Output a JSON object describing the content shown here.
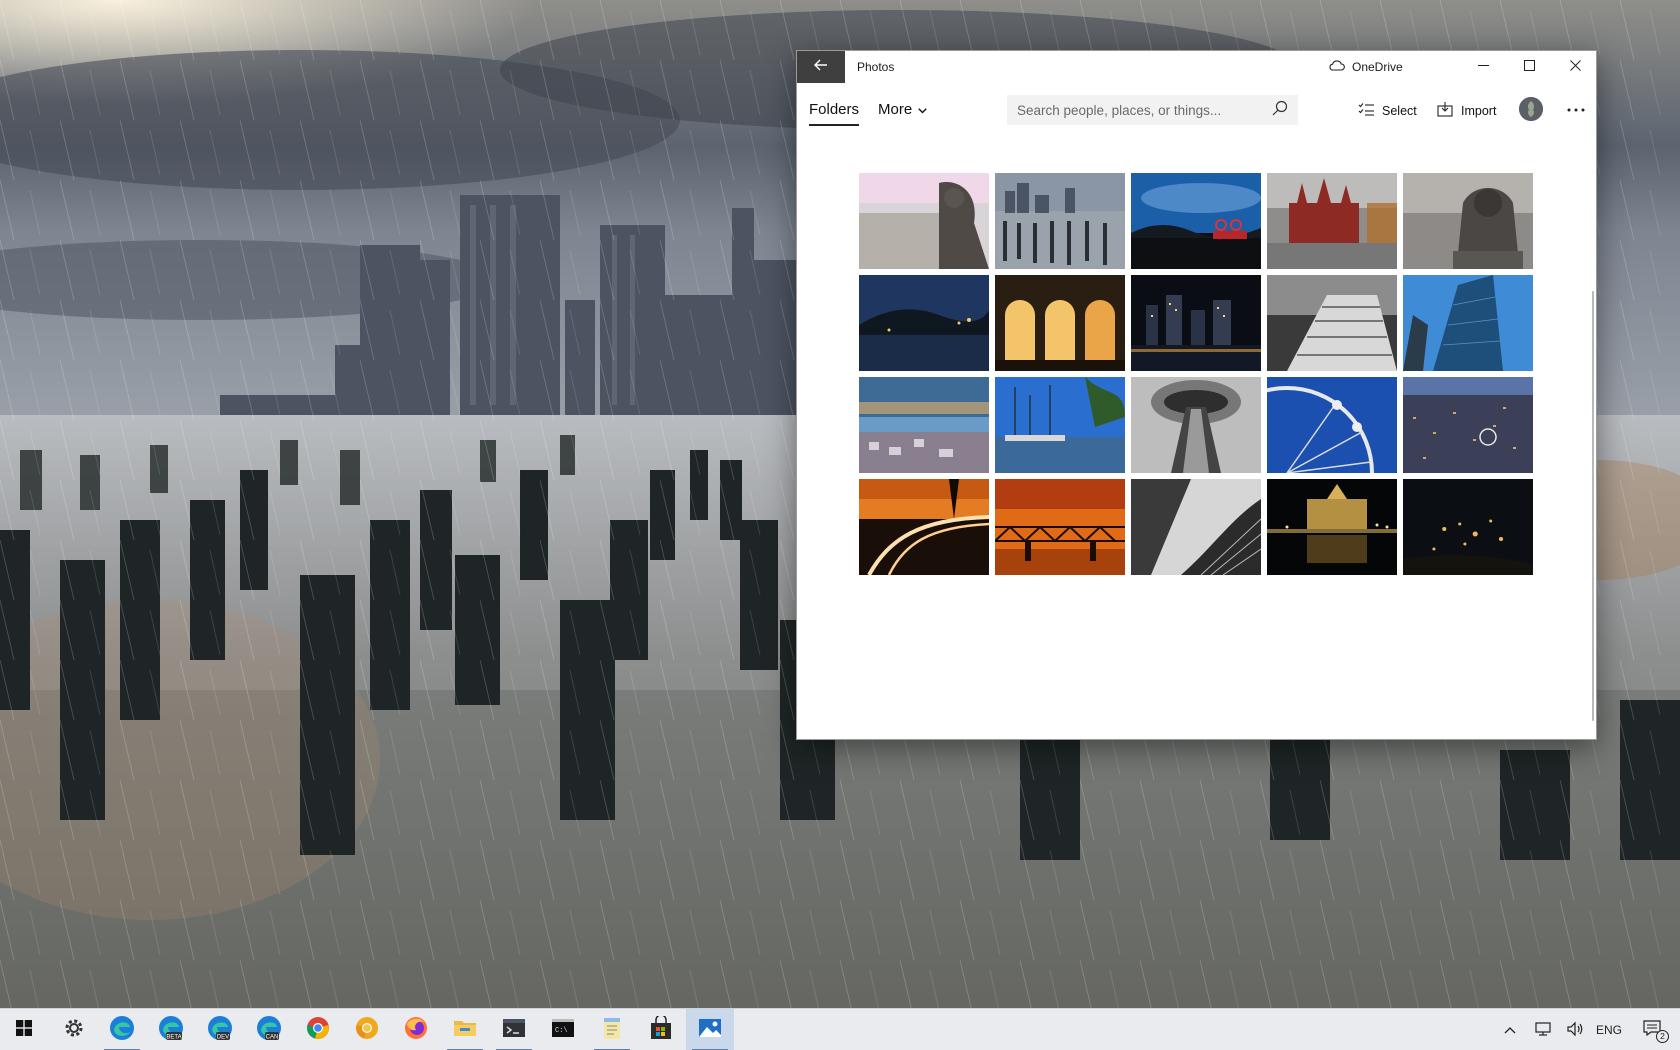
{
  "window": {
    "title": "Photos",
    "onedrive_label": "OneDrive",
    "tabs": [
      {
        "label": "Folders",
        "active": true
      },
      {
        "label": "More",
        "active": false
      }
    ],
    "search": {
      "placeholder": "Search people, places, or things..."
    },
    "toolbar": {
      "select_label": "Select",
      "import_label": "Import"
    }
  },
  "gallery": {
    "thumbnails": [
      {
        "subject": "gargoyle-over-city"
      },
      {
        "subject": "pier-pilings-skyline"
      },
      {
        "subject": "blue-sky-harbor"
      },
      {
        "subject": "red-museum-building"
      },
      {
        "subject": "stone-lion-statue"
      },
      {
        "subject": "night-hills-lake"
      },
      {
        "subject": "arches-at-sunset"
      },
      {
        "subject": "city-lights-night"
      },
      {
        "subject": "white-bridge-bw"
      },
      {
        "subject": "glass-skyscraper"
      },
      {
        "subject": "coastal-town-dusk"
      },
      {
        "subject": "sailboats-marina"
      },
      {
        "subject": "space-needle-bw"
      },
      {
        "subject": "ferris-wheel-blue"
      },
      {
        "subject": "city-aerial-night"
      },
      {
        "subject": "light-trails-road"
      },
      {
        "subject": "bridge-orange-sunset"
      },
      {
        "subject": "building-curves-bw"
      },
      {
        "subject": "palace-reflection-night"
      },
      {
        "subject": "village-lights-night"
      }
    ]
  },
  "taskbar": {
    "items": [
      {
        "name": "start",
        "icon": "windows-logo-icon"
      },
      {
        "name": "settings",
        "icon": "gear-icon"
      },
      {
        "name": "edge",
        "icon": "edge-icon"
      },
      {
        "name": "edge-beta",
        "icon": "edge-beta-icon",
        "badge": "BETA"
      },
      {
        "name": "edge-dev",
        "icon": "edge-dev-icon",
        "badge": "DEV"
      },
      {
        "name": "edge-canary",
        "icon": "edge-canary-icon",
        "badge": "CAN"
      },
      {
        "name": "chrome",
        "icon": "chrome-icon"
      },
      {
        "name": "chrome-canary",
        "icon": "chrome-canary-icon"
      },
      {
        "name": "firefox",
        "icon": "firefox-icon"
      },
      {
        "name": "file-explorer",
        "icon": "folder-icon"
      },
      {
        "name": "terminal",
        "icon": "terminal-icon"
      },
      {
        "name": "command-prompt",
        "icon": "cmd-icon"
      },
      {
        "name": "notepad",
        "icon": "notepad-icon"
      },
      {
        "name": "store",
        "icon": "store-icon"
      },
      {
        "name": "photos",
        "icon": "photos-icon",
        "active": true
      }
    ],
    "tray": {
      "language": "ENG",
      "notification_count": "2"
    }
  },
  "colors": {
    "taskbar_bg": "#e9ebee",
    "back_button_bg": "#3f3f3f",
    "active_task_bg": "#c9d8ea"
  }
}
